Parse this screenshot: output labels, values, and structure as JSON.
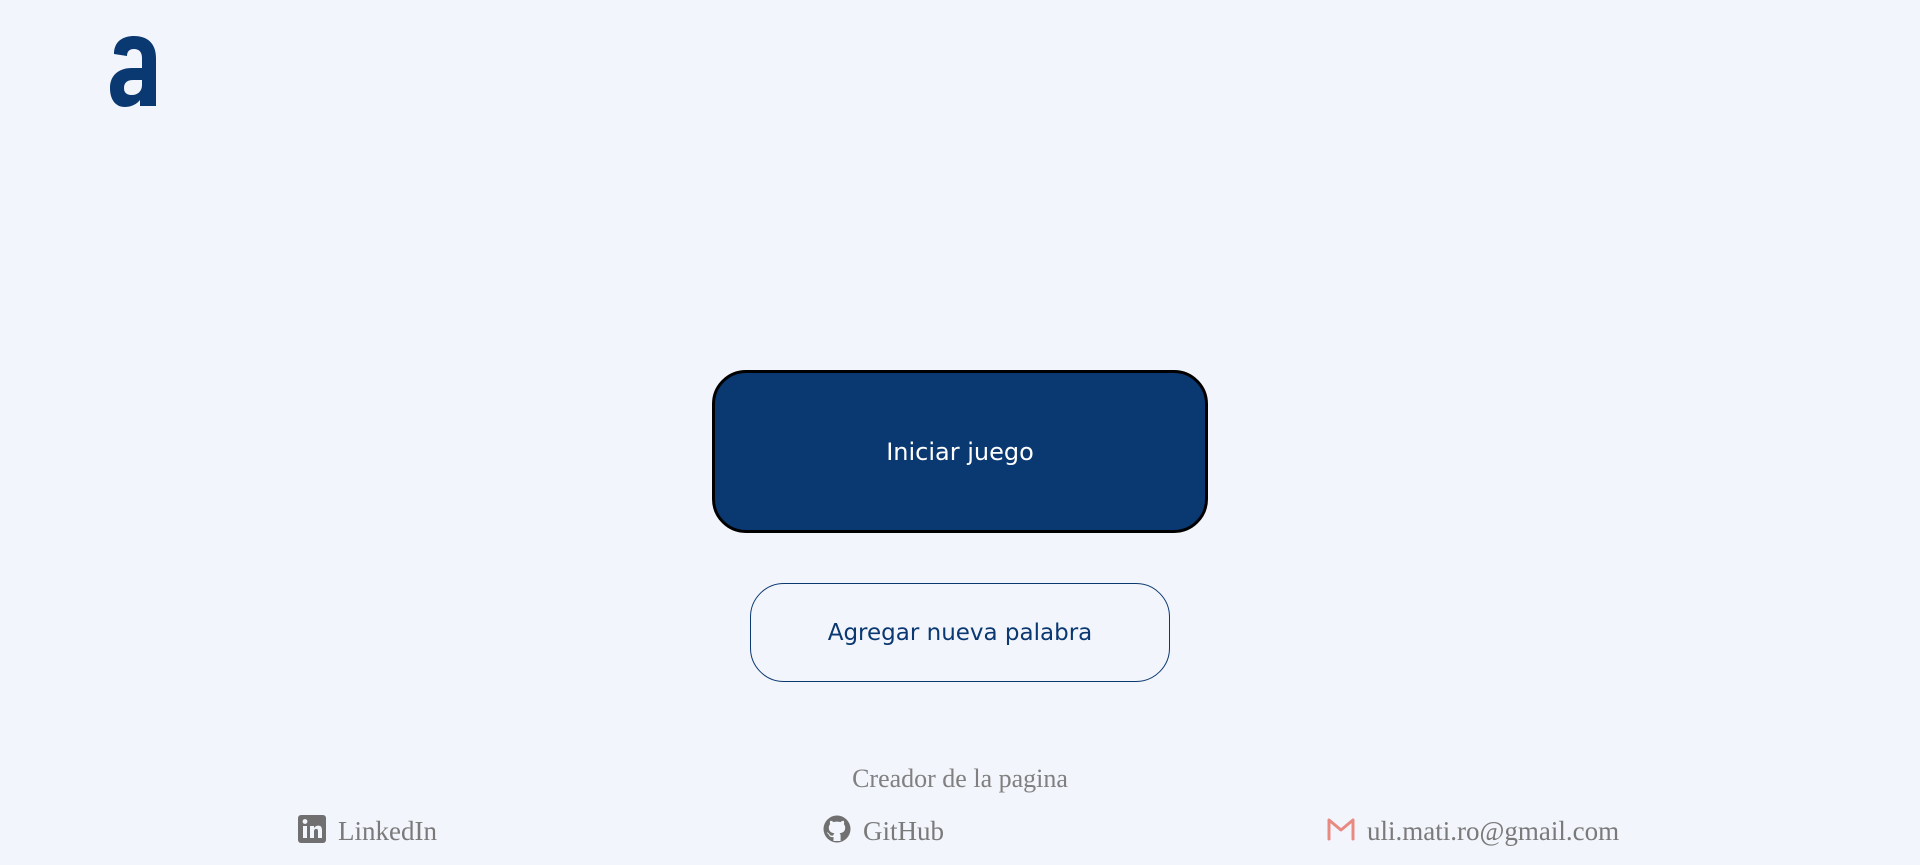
{
  "colors": {
    "background": "#f3f5fc",
    "brand": "#0a3871",
    "footer_text": "#7a7a7a",
    "gmail_icon": "#e88a82"
  },
  "logo": {
    "icon": "alura-logo-icon"
  },
  "actions": {
    "start_label": "Iniciar juego",
    "add_word_label": "Agregar nueva palabra"
  },
  "footer": {
    "title": "Creador de la pagina",
    "links": [
      {
        "icon": "linkedin-icon",
        "label": "LinkedIn"
      },
      {
        "icon": "github-icon",
        "label": "GitHub"
      },
      {
        "icon": "gmail-icon",
        "label": "uli.mati.ro@gmail.com"
      }
    ]
  }
}
